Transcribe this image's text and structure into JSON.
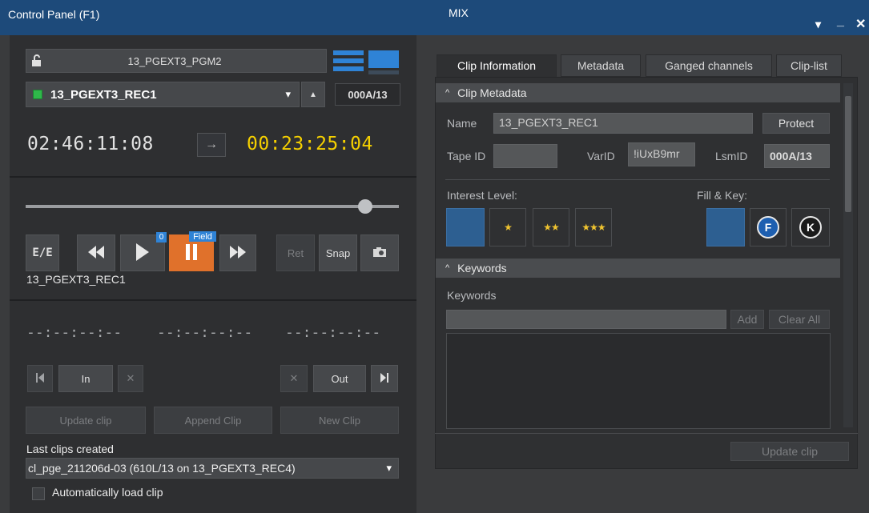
{
  "window": {
    "left_title": "Control Panel (F1)",
    "right_title": "MIX",
    "minimize": "▾",
    "restore": "_",
    "close": "✕"
  },
  "player": {
    "channel_name": "13_PGEXT3_PGM2",
    "clip_name": "13_PGEXT3_REC1",
    "clip_id": "000A/13",
    "timecode_current": "02:46:11:08",
    "timecode_remaining": "00:23:25:04",
    "arrow_symbol": "→",
    "eject_symbol": "▲",
    "dropdown_symbol": "▾",
    "slider_position": 0.91
  },
  "transport": {
    "ee_label": "E/E",
    "play_badge": "0",
    "pause_badge": "Field",
    "ret_label": "Ret",
    "snap_label": "Snap",
    "clip_label": "13_PGEXT3_REC1"
  },
  "marks": {
    "tc_in": "--:--:--:--",
    "tc_out": "--:--:--:--",
    "tc_dur": "--:--:--:--",
    "in_label": "In",
    "out_label": "Out",
    "x_symbol": "✕",
    "update_clip": "Update clip",
    "append_clip": "Append Clip",
    "new_clip": "New Clip",
    "last_clips_label": "Last clips created",
    "last_clip_value": "cl_pge_211206d-03 (610L/13 on 13_PGEXT3_REC4)",
    "auto_load_label": "Automatically load clip"
  },
  "tabs": [
    "Clip Information",
    "Metadata",
    "Ganged channels",
    "Clip-list"
  ],
  "clip_metadata": {
    "section_title": "Clip Metadata",
    "name_label": "Name",
    "name_value": "13_PGEXT3_REC1",
    "protect_label": "Protect",
    "tape_id_label": "Tape ID",
    "tape_id_value": "",
    "varid_label": "VarID",
    "varid_value": "!iUxB9mr",
    "lsmid_label": "LsmID",
    "lsmid_value": "000A/13",
    "interest_label": "Interest Level:",
    "star1": "★",
    "star2": "★★",
    "star3": "★★★",
    "fill_key_label": "Fill & Key:",
    "fill_letter": "F",
    "key_letter": "K"
  },
  "keywords": {
    "section_title": "Keywords",
    "label": "Keywords",
    "input_value": "",
    "add_label": "Add",
    "clear_all_label": "Clear All"
  },
  "footer": {
    "update_clip": "Update clip"
  },
  "colors": {
    "title_bar": "#1d4a7a",
    "accent_blue": "#2d5f91",
    "pause_orange": "#e0712b",
    "timecode_yellow": "#f5d000"
  }
}
